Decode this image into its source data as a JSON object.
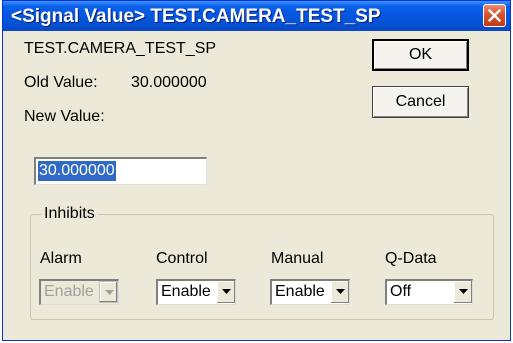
{
  "dialog": {
    "title": "<Signal Value> TEST.CAMERA_TEST_SP",
    "signal_name": "TEST.CAMERA_TEST_SP",
    "old_value_label": "Old Value:",
    "old_value": "30.000000",
    "new_value_label": "New Value:",
    "new_value": "30.000000",
    "ok_label": "OK",
    "cancel_label": "Cancel"
  },
  "inhibits": {
    "title": "Inhibits",
    "fields": [
      {
        "label": "Alarm",
        "value": "Enable",
        "disabled": true
      },
      {
        "label": "Control",
        "value": "Enable",
        "disabled": false
      },
      {
        "label": "Manual",
        "value": "Enable",
        "disabled": false
      },
      {
        "label": "Q-Data",
        "value": "Off",
        "disabled": false
      }
    ]
  },
  "colors": {
    "titlebar": "#0556e0",
    "window_bg": "#ece9d8",
    "selection": "#316ac5",
    "close_button": "#d7522f"
  },
  "icons": {
    "close": "close-icon",
    "dropdown": "chevron-down-icon"
  }
}
